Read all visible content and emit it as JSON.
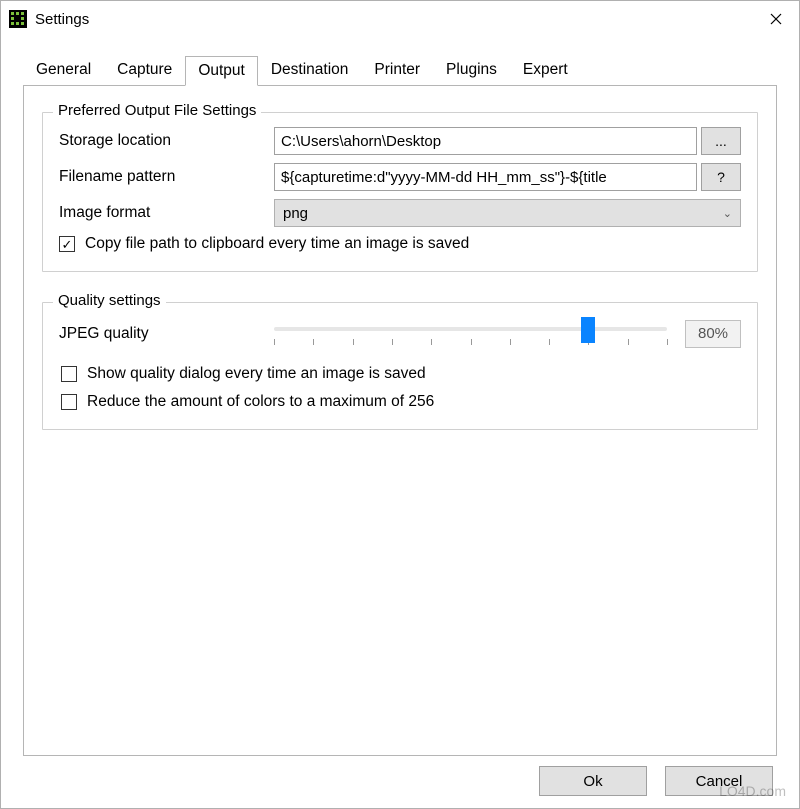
{
  "window": {
    "title": "Settings",
    "close_icon": "×"
  },
  "tabs": [
    {
      "label": "General"
    },
    {
      "label": "Capture"
    },
    {
      "label": "Output"
    },
    {
      "label": "Destination"
    },
    {
      "label": "Printer"
    },
    {
      "label": "Plugins"
    },
    {
      "label": "Expert"
    }
  ],
  "output_group": {
    "legend": "Preferred Output File Settings",
    "storage_label": "Storage location",
    "storage_value": "C:\\Users\\ahorn\\Desktop",
    "browse_label": "...",
    "filename_label": "Filename pattern",
    "filename_value": "${capturetime:d\"yyyy-MM-dd HH_mm_ss\"}-${title",
    "help_label": "?",
    "format_label": "Image format",
    "format_value": "png",
    "copy_clipboard_label": "Copy file path to clipboard every time an image is saved",
    "copy_clipboard_checked": true
  },
  "quality_group": {
    "legend": "Quality settings",
    "jpeg_label": "JPEG quality",
    "jpeg_value": 80,
    "jpeg_display": "80%",
    "show_dialog_label": "Show quality dialog every time an image is saved",
    "show_dialog_checked": false,
    "reduce_colors_label": "Reduce the amount of colors to a maximum of 256",
    "reduce_colors_checked": false
  },
  "buttons": {
    "ok": "Ok",
    "cancel": "Cancel"
  },
  "watermark": "LO4D.com"
}
